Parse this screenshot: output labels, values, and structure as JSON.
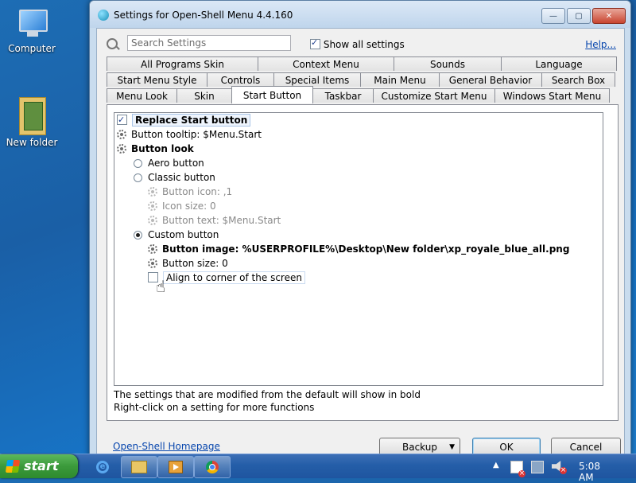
{
  "desktop": {
    "icons": [
      {
        "label": "Computer"
      },
      {
        "label": "New folder"
      }
    ]
  },
  "window": {
    "title": "Settings for Open-Shell Menu 4.4.160",
    "caption": {
      "minimize": "—",
      "maximize": "▢",
      "close": "✕"
    }
  },
  "search": {
    "placeholder": "Search Settings",
    "value": "",
    "show_all_label": "Show all settings",
    "show_all_checked": true,
    "help_label": "Help..."
  },
  "tabs": {
    "row1": [
      "All Programs Skin",
      "Context Menu",
      "Sounds",
      "Language"
    ],
    "row2": [
      "Start Menu Style",
      "Controls",
      "Special Items",
      "Main Menu",
      "General Behavior",
      "Search Box"
    ],
    "row3": [
      "Menu Look",
      "Skin",
      "Start Button",
      "Taskbar",
      "Customize Start Menu",
      "Windows Start Menu"
    ],
    "active": "Start Button"
  },
  "tree": {
    "replace_start_button": "Replace Start button",
    "button_tooltip": "Button tooltip: $Menu.Start",
    "button_look": "Button look",
    "aero_button": "Aero button",
    "classic_button": "Classic button",
    "button_icon": "Button icon: ,1",
    "icon_size": "Icon size: 0",
    "button_text": "Button text: $Menu.Start",
    "custom_button": "Custom button",
    "button_image": "Button image: %USERPROFILE%\\Desktop\\New folder\\xp_royale_blue_all.png",
    "button_size": "Button size: 0",
    "align_corner": "Align to corner of the screen"
  },
  "notes": {
    "line1": "The settings that are modified from the default will show in bold",
    "line2": "Right-click on a setting for more functions"
  },
  "footer": {
    "homepage_link": "Open-Shell Homepage",
    "backup_label": "Backup",
    "backup_arrow": "▼",
    "ok_label": "OK",
    "cancel_label": "Cancel"
  },
  "taskbar": {
    "start_label": "start",
    "tray_arrow": "▲",
    "clock": "5:08 AM"
  }
}
